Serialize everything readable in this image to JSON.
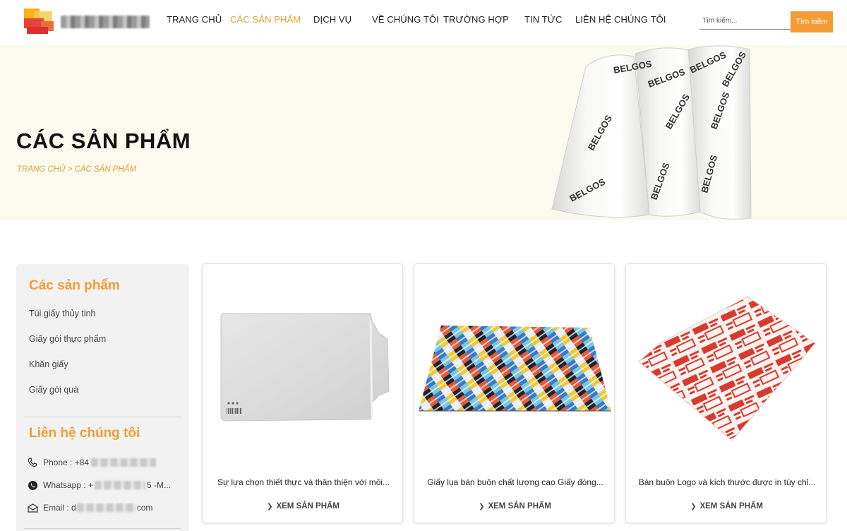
{
  "header": {
    "logo_icon": "company-logo",
    "nav": [
      {
        "label": "TRANG CHỦ",
        "active": false
      },
      {
        "label": "CÁC SẢN PHẨM",
        "active": true
      },
      {
        "label": "DỊCH VỤ",
        "active": false
      },
      {
        "label": "VỀ CHÚNG TÔI",
        "active": false
      },
      {
        "label": "TRƯỜNG HỢP",
        "active": false
      },
      {
        "label": "TIN TỨC",
        "active": false
      },
      {
        "label": "LIÊN HỆ CHÚNG TÔI",
        "active": false
      }
    ],
    "search_placeholder": "Tìm kiếm...",
    "search_button": "Tìm kiếm"
  },
  "banner": {
    "title": "CÁC SẢN PHẨM",
    "breadcrumb": {
      "home": "TRANG CHỦ",
      "separator": " > ",
      "current": "CÁC SẢN PHẨM"
    },
    "print_text": "BELGOS"
  },
  "sidebar": {
    "products_heading": "Các sản phẩm",
    "products": [
      "Túi giấy thủy tinh",
      "Giấy gói thực phẩm",
      "Khăn giấy",
      "Giấy gói quà"
    ],
    "contact_heading": "Liên hệ chúng tôi",
    "contacts": [
      {
        "icon": "phone-icon",
        "label": "Phone : +84",
        "suffix": ""
      },
      {
        "icon": "whatsapp-icon",
        "label": "Whatsapp : +",
        "suffix": "5 -M..."
      },
      {
        "icon": "email-icon",
        "label": "Email : d",
        "suffix": "com"
      }
    ]
  },
  "products": [
    {
      "title": "Sự lựa chọn thiết thực và thân thiện với môi...",
      "link": "XEM SẢN PHẨM"
    },
    {
      "title": "Giấy lụa bán buôn chất lượng cao Giấy đóng...",
      "link": "XEM SẢN PHẨM"
    },
    {
      "title": "Bán buôn Logo và kích thước được in tùy chỉ...",
      "link": "XEM SẢN PHẨM"
    }
  ],
  "colors": {
    "accent": "#f39c33",
    "banner_bg": "#fbfaee",
    "sidebar_bg": "#f2f2f2",
    "print_red": "#d83a2f"
  }
}
